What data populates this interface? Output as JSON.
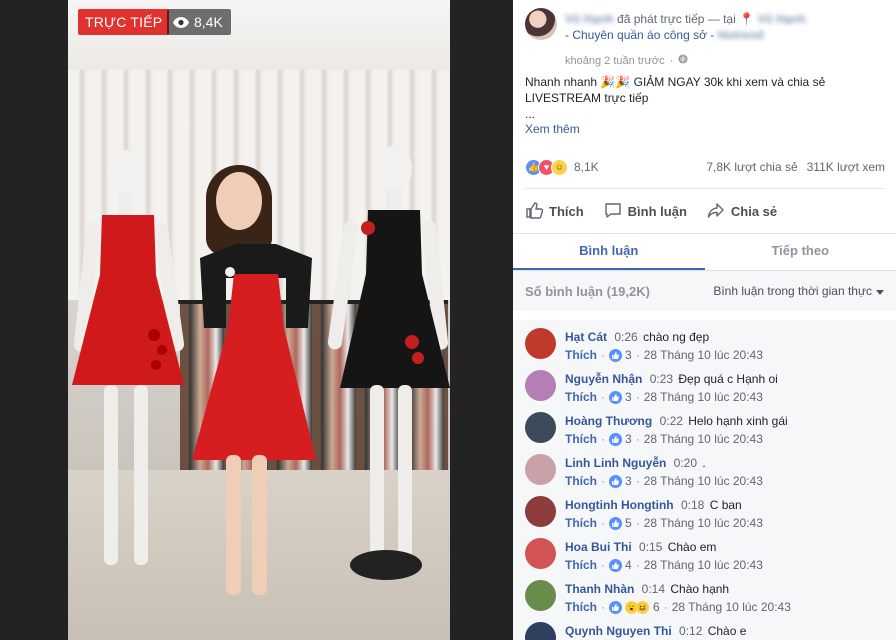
{
  "video": {
    "live_label": "TRỰC TIẾP",
    "viewer_count": "8,4K"
  },
  "post": {
    "author_name": "Vũ Hạnh",
    "action_text": "đã phát trực tiếp — tại",
    "place_name": "Vũ Hạnh",
    "place_detail": "- Chuyên quần áo công sở -",
    "place_brand": "Hotrend",
    "time": "khoảng 2 tuần trước",
    "body_line1": "Nhanh nhanh 🎉🎉 GIẢM NGAY 30k khi xem và chia sẻ",
    "body_line2": "LIVESTREAM trực tiếp",
    "body_line3": "...",
    "see_more": "Xem thêm",
    "reaction_count": "8,1K",
    "shares": "7,8K lượt chia sẻ",
    "views": "311K lượt xem",
    "like_label": "Thích",
    "comment_label": "Bình luận",
    "share_label": "Chia sẻ"
  },
  "tabs": [
    {
      "label": "Bình luận"
    },
    {
      "label": "Tiếp theo"
    }
  ],
  "comments_header": {
    "count": "Số bình luận (19,2K)",
    "sort": "Bình luận trong thời gian thực"
  },
  "comments": [
    {
      "name": "Hạt Cát",
      "time": "0:26",
      "text": "chào ng đẹp",
      "like": "Thích",
      "likes": "3",
      "date": "28 Tháng 10 lúc 20:43",
      "avatar": "#c0392b"
    },
    {
      "name": "Nguyễn Nhận",
      "time": "0:23",
      "text": "Đẹp quá c Hạnh oi",
      "like": "Thích",
      "likes": "3",
      "date": "28 Tháng 10 lúc 20:43",
      "avatar": "#b47fb6"
    },
    {
      "name": "Hoàng Thương",
      "time": "0:22",
      "text": "Helo hạnh xinh gái",
      "like": "Thích",
      "likes": "3",
      "date": "28 Tháng 10 lúc 20:43",
      "avatar": "#3c4a5a"
    },
    {
      "name": "Linh Linh Nguyễn",
      "time": "0:20",
      "text": ".",
      "like": "Thích",
      "likes": "3",
      "date": "28 Tháng 10 lúc 20:43",
      "avatar": "#c8a2a8"
    },
    {
      "name": "Hongtinh Hongtinh",
      "time": "0:18",
      "text": "C ban",
      "like": "Thích",
      "likes": "5",
      "date": "28 Tháng 10 lúc 20:43",
      "avatar": "#8e3b3b"
    },
    {
      "name": "Hoa Bui Thi",
      "time": "0:15",
      "text": "Chào em",
      "like": "Thích",
      "likes": "4",
      "date": "28 Tháng 10 lúc 20:43",
      "avatar": "#d35454"
    },
    {
      "name": "Thanh Nhàn",
      "time": "0:14",
      "text": "Chào hạnh",
      "like": "Thích",
      "likes": "6",
      "date": "28 Tháng 10 lúc 20:43",
      "avatar": "#6a8c4a"
    },
    {
      "name": "Quynh Nguyen Thi",
      "time": "0:12",
      "text": "Chào e",
      "like": "",
      "likes": "",
      "date": "",
      "avatar": "#2f3f5f"
    }
  ]
}
